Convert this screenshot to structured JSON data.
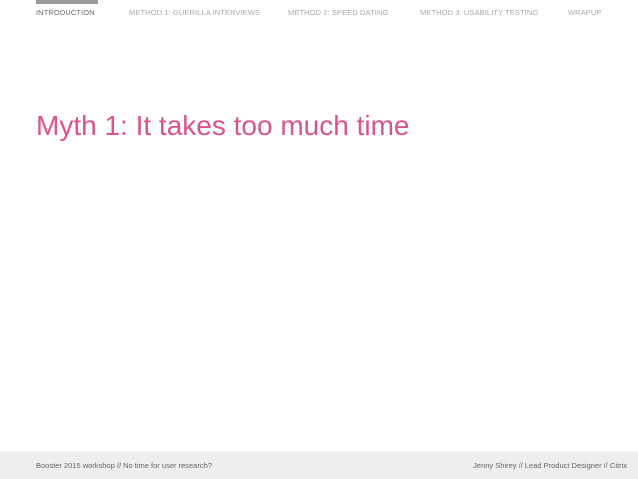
{
  "nav": {
    "items": [
      {
        "label": "INTRODUCTION",
        "active": true
      },
      {
        "label": "METHOD 1: GUERILLA INTERVIEWS",
        "active": false
      },
      {
        "label": "METHOD 2: SPEED DATING",
        "active": false
      },
      {
        "label": "METHOD 3: USABILITY TESTING",
        "active": false
      },
      {
        "label": "WRAPUP",
        "active": false
      }
    ]
  },
  "slide": {
    "title": "Myth 1: It takes too much time"
  },
  "footer": {
    "left": "Booster 2015 workshop  //  No time for user research?",
    "right": "Jenny Shirey  //  Lead Product Designer  //  Citrix"
  },
  "colors": {
    "title": "#d9548a",
    "nav_text": "#a8a8a8",
    "nav_active_text": "#6b6b6b",
    "active_indicator": "#9a9a9a",
    "footer_bg": "#eeeeee",
    "footer_text": "#666666"
  }
}
